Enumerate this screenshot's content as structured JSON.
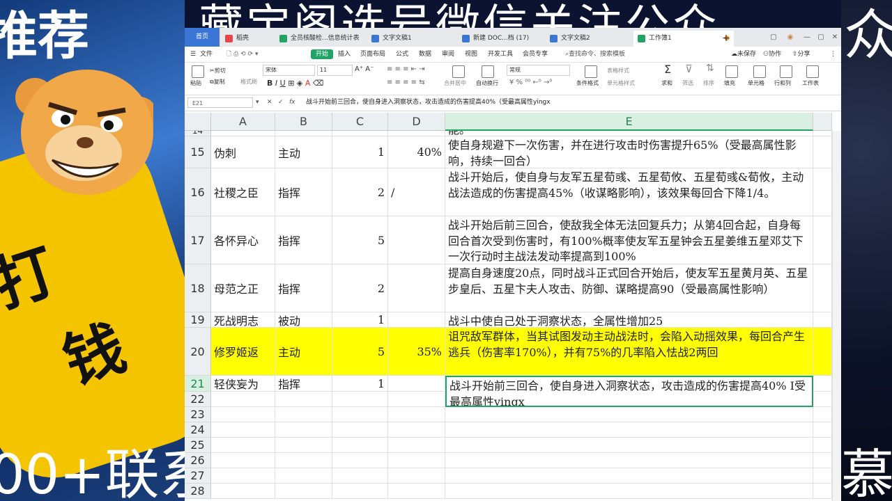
{
  "background": {
    "banner_text": "藏宝阁选号微信关注公众",
    "left_top_text": "推荐",
    "left_bottom_text": "00+联系",
    "right_top_text": "众",
    "right_bottom_text": "慕予",
    "band_text_1": "打",
    "band_text_2": "钱"
  },
  "tabs": [
    {
      "label": "首页",
      "kind": "home"
    },
    {
      "label": "稻壳",
      "color": "#e8474c"
    },
    {
      "label": "全员核酸检...信息统计表",
      "color": "#21a366"
    },
    {
      "label": "文字文稿1",
      "color": "#3a76d6"
    },
    {
      "label": "新建 DOC...档 (17)",
      "color": "#3a76d6"
    },
    {
      "label": "文字文稿2",
      "color": "#3a76d6"
    },
    {
      "label": "工作簿1",
      "color": "#21a366",
      "active": true
    }
  ],
  "window_controls": [
    "▢",
    "◉",
    "—",
    "▢",
    "✕"
  ],
  "menu": {
    "file": "文件",
    "items": [
      "开始",
      "插入",
      "页面布局",
      "公式",
      "数据",
      "审阅",
      "视图",
      "开发工具",
      "会员专享"
    ],
    "active": "开始",
    "find": "查找命令、搜索模板",
    "unsaved": "未保存",
    "collab": "协作",
    "share": "分享"
  },
  "ribbon": {
    "paste": "粘贴",
    "cut": "剪切",
    "copy": "复制",
    "format_painter": "格式刷",
    "font": "宋体",
    "size": "11",
    "merge": "合并居中",
    "wrap": "自动换行",
    "number_format": "常规",
    "cond_format": "条件格式",
    "table_style": "表格样式",
    "cell_style": "单元格样式",
    "sum": "求和",
    "filter": "筛选",
    "sort": "排序",
    "fill": "填充",
    "cells": "单元格",
    "rowcol": "行和列",
    "sheet": "工作表"
  },
  "formula_bar": {
    "name_box": "E21",
    "fx": "fx",
    "content": "战斗开始前三回合，使自身进入洞察状态，攻击造成的伤害提高40%（受最高属性yingx"
  },
  "columns": [
    "A",
    "B",
    "C",
    "D",
    "E"
  ],
  "selected_column": "E",
  "rows": [
    {
      "row": "14",
      "a": "",
      "b": "",
      "c": "",
      "d": "",
      "e": "能。"
    },
    {
      "row": "15",
      "a": "伪刺",
      "b": "主动",
      "c": "1",
      "d": "40%",
      "e": "使自身规避下一次伤害，并在进行攻击时伤害提升65%（受最高属性影响，持续一回合）"
    },
    {
      "row": "16",
      "a": "社稷之臣",
      "b": "指挥",
      "c": "2",
      "d": "/",
      "e": "战斗开始后，使自身与友军五星荀彧、五星荀攸、五星荀彧&荀攸，主动战法造成的伤害提高45%（收谋略影响），该效果每回合下降1/4。"
    },
    {
      "row": "17",
      "a": "各怀异心",
      "b": "指挥",
      "c": "5",
      "d": "",
      "e": "战斗开始后前三回合，使敌我全体无法回复兵力；从第4回合起，自身每回合首次受到伤害时，有100%概率使友军五星钟会五星姜维五星邓艾下一次行动时主战法发动率提高到100%"
    },
    {
      "row": "18",
      "a": "母范之正",
      "b": "指挥",
      "c": "2",
      "d": "",
      "e": "提高自身速度20点，同时战斗正式回合开始后，使友军五星黄月英、五星步皇后、五星卞夫人攻击、防御、谋略提高90（受最高属性影响）"
    },
    {
      "row": "19",
      "a": "死战明志",
      "b": "被动",
      "c": "1",
      "d": "",
      "e": "战斗中使自己处于洞察状态，全属性增加25"
    },
    {
      "row": "20",
      "a": "修罗姬返",
      "b": "主动",
      "c": "5",
      "d": "35%",
      "e": "诅咒敌军群体，当其试图发动主动战法时，会陷入动摇效果，每回合产生逃兵（伤害率170%），并有75%的几率陷入怯战2两回"
    },
    {
      "row": "21",
      "a": "轻侠妄为",
      "b": "指挥",
      "c": "1",
      "d": "",
      "e": "战斗开始前三回合，使自身进入洞察状态，攻击造成的伤害提高40% I受最高属性yingx"
    },
    {
      "row": "22",
      "a": "",
      "b": "",
      "c": "",
      "d": "",
      "e": ""
    },
    {
      "row": "23",
      "a": "",
      "b": "",
      "c": "",
      "d": "",
      "e": ""
    },
    {
      "row": "24",
      "a": "",
      "b": "",
      "c": "",
      "d": "",
      "e": ""
    },
    {
      "row": "25",
      "a": "",
      "b": "",
      "c": "",
      "d": "",
      "e": ""
    },
    {
      "row": "26",
      "a": "",
      "b": "",
      "c": "",
      "d": "",
      "e": ""
    },
    {
      "row": "27",
      "a": "",
      "b": "",
      "c": "",
      "d": "",
      "e": ""
    },
    {
      "row": "28",
      "a": "",
      "b": "",
      "c": "",
      "d": "",
      "e": ""
    }
  ],
  "highlight_color": "#ffff00",
  "accent_color": "#21a366"
}
